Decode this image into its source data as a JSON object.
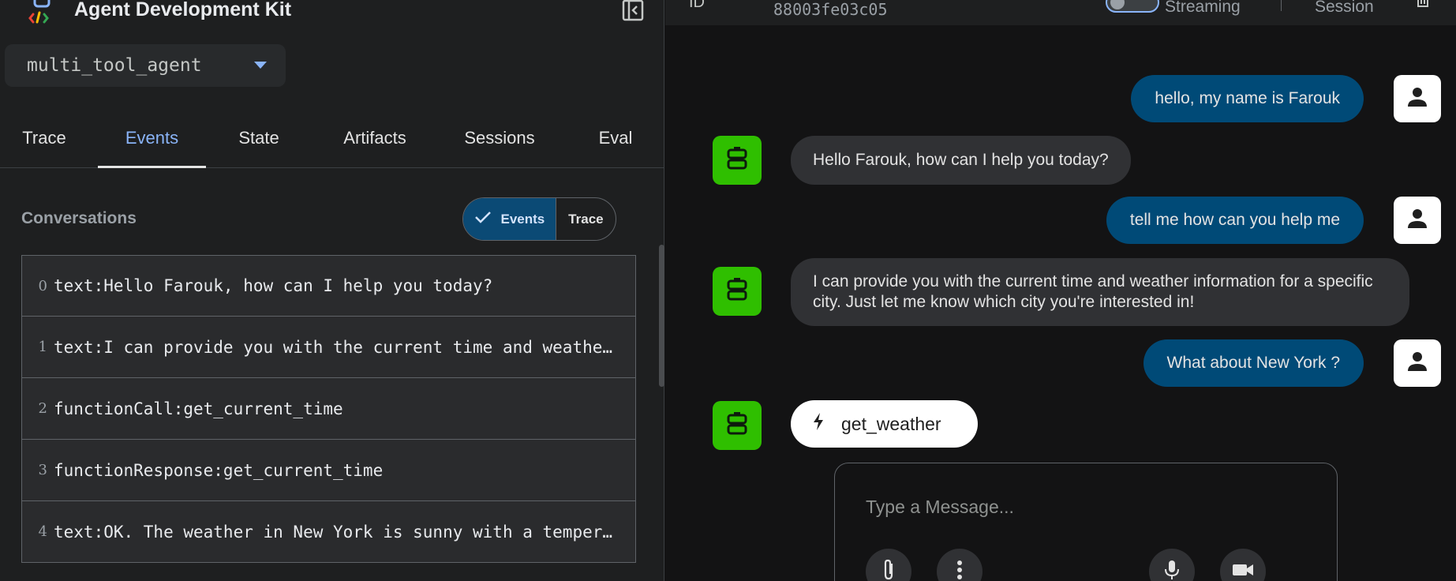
{
  "sidebar": {
    "app_title": "Agent Development Kit",
    "agent_select": {
      "value": "multi_tool_agent"
    },
    "tabs": [
      {
        "label": "Trace"
      },
      {
        "label": "Events",
        "active": true
      },
      {
        "label": "State"
      },
      {
        "label": "Artifacts"
      },
      {
        "label": "Sessions"
      },
      {
        "label": "Eval"
      }
    ],
    "conversations_title": "Conversations",
    "view_toggle": {
      "events_label": "Events",
      "trace_label": "Trace",
      "selected": "Events"
    },
    "events": [
      {
        "index": "0",
        "text": "text:Hello Farouk, how can I help you today?"
      },
      {
        "index": "1",
        "text": "text:I can provide you with the current time and weather information for a specific city. Just let me know which city you're interested in!"
      },
      {
        "index": "2",
        "text": "functionCall:get_current_time"
      },
      {
        "index": "3",
        "text": "functionResponse:get_current_time"
      },
      {
        "index": "4",
        "text": "text:OK. The weather in New York is sunny with a temperature"
      }
    ]
  },
  "topbar": {
    "id_label": "ID",
    "session_id": "88003fe03c05",
    "streaming_label": "Streaming",
    "streaming_on": false,
    "session_label": "Session"
  },
  "chat": {
    "messages": [
      {
        "role": "user",
        "text": "hello, my name is Farouk"
      },
      {
        "role": "bot",
        "text": "Hello Farouk, how can I help you today?"
      },
      {
        "role": "user",
        "text": "tell me how can you help me"
      },
      {
        "role": "bot",
        "text": "I can provide you with the current time and weather information for a specific city. Just let me know which city you're interested in!"
      },
      {
        "role": "user",
        "text": "What about New York ?"
      }
    ],
    "function_call_chip": "get_weather",
    "composer_placeholder": "Type a Message..."
  },
  "colors": {
    "accent": "#8ab4f8",
    "user_bubble": "#004a77",
    "bot_avatar": "#2fbf00",
    "bot_bubble": "#303134"
  }
}
